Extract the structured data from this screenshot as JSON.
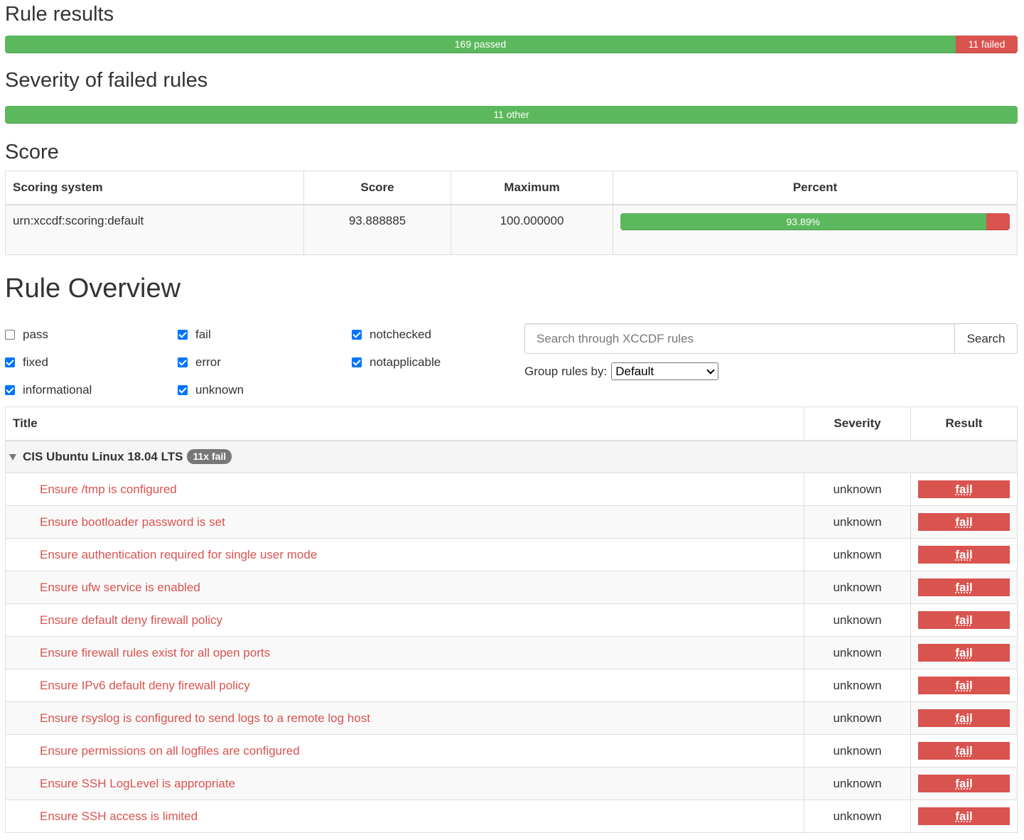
{
  "rule_results": {
    "heading": "Rule results",
    "passed_label": "169 passed",
    "failed_label": "11 failed",
    "passed_fraction": 0.9389,
    "failed_fraction": 0.0611
  },
  "severity": {
    "heading": "Severity of failed rules",
    "other_label": "11 other",
    "other_fraction": 1.0
  },
  "score": {
    "heading": "Score",
    "columns": [
      "Scoring system",
      "Score",
      "Maximum",
      "Percent"
    ],
    "row": {
      "system": "urn:xccdf:scoring:default",
      "score": "93.888885",
      "maximum": "100.000000",
      "percent_label": "93.89%",
      "percent_fraction": 0.9389
    }
  },
  "overview": {
    "heading": "Rule Overview",
    "filters": [
      {
        "label": "pass",
        "checked": false
      },
      {
        "label": "fail",
        "checked": true
      },
      {
        "label": "notchecked",
        "checked": true
      },
      {
        "label": "fixed",
        "checked": true
      },
      {
        "label": "error",
        "checked": true
      },
      {
        "label": "notapplicable",
        "checked": true
      },
      {
        "label": "informational",
        "checked": true
      },
      {
        "label": "unknown",
        "checked": true
      }
    ],
    "search_placeholder": "Search through XCCDF rules",
    "search_button": "Search",
    "group_by_label": "Group rules by:",
    "group_by_value": "Default"
  },
  "rules_table": {
    "columns": {
      "title": "Title",
      "severity": "Severity",
      "result": "Result"
    },
    "group": {
      "name": "CIS Ubuntu Linux 18.04 LTS",
      "badge": "11x fail"
    },
    "rows": [
      {
        "title": "Ensure /tmp is configured",
        "severity": "unknown",
        "result": "fail"
      },
      {
        "title": "Ensure bootloader password is set",
        "severity": "unknown",
        "result": "fail"
      },
      {
        "title": "Ensure authentication required for single user mode",
        "severity": "unknown",
        "result": "fail"
      },
      {
        "title": "Ensure ufw service is enabled",
        "severity": "unknown",
        "result": "fail"
      },
      {
        "title": "Ensure default deny firewall policy",
        "severity": "unknown",
        "result": "fail"
      },
      {
        "title": "Ensure firewall rules exist for all open ports",
        "severity": "unknown",
        "result": "fail"
      },
      {
        "title": "Ensure IPv6 default deny firewall policy",
        "severity": "unknown",
        "result": "fail"
      },
      {
        "title": "Ensure rsyslog is configured to send logs to a remote log host",
        "severity": "unknown",
        "result": "fail"
      },
      {
        "title": "Ensure permissions on all logfiles are configured",
        "severity": "unknown",
        "result": "fail"
      },
      {
        "title": "Ensure SSH LogLevel is appropriate",
        "severity": "unknown",
        "result": "fail"
      },
      {
        "title": "Ensure SSH access is limited",
        "severity": "unknown",
        "result": "fail"
      }
    ]
  },
  "colors": {
    "success": "#5cb85c",
    "danger": "#d9534f",
    "badge": "#777777"
  }
}
